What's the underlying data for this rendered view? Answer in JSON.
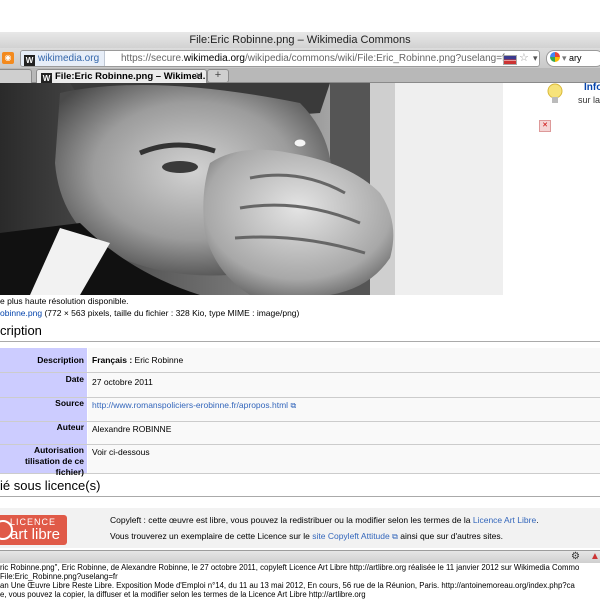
{
  "window": {
    "title": "File:Eric Robinne.png – Wikimedia Commons"
  },
  "navbar": {
    "site_label": "wikimedia.org",
    "url_prefix": "https://secure.",
    "url_domain": "wikimedia.org",
    "url_rest": "/wikipedia/commons/wiki/File:Eric_Robinne.png?uselang=fr",
    "search_value": "ary"
  },
  "tabs": [
    {
      "label": ""
    },
    {
      "label": "File:Eric Robinne.png – Wikimed..."
    }
  ],
  "side": {
    "info_label": "Info",
    "info_sub": "sur la"
  },
  "file": {
    "resolution_text": "e plus haute résolution disponible.",
    "filename": "obinne.png",
    "dimensions": "(772 × 563 pixels, taille du fichier : 328 Kio, type MIME : image/png)"
  },
  "headings": {
    "description": "cription",
    "license": "ié sous licence(s)"
  },
  "info_rows": [
    {
      "label": "Description",
      "value_bold": "Français :",
      "value": "Eric Robinne"
    },
    {
      "label": "Date",
      "value": "27 octobre 2011"
    },
    {
      "label": "Source",
      "value": "http://www.romanspoliciers-erobinne.fr/apropos.html"
    },
    {
      "label": "Auteur",
      "value": "Alexandre ROBINNE"
    },
    {
      "label": "Autorisation",
      "label2": "tilisation de ce fichier)",
      "value": "Voir ci-dessous"
    }
  ],
  "license": {
    "logo_top": "LICENCE",
    "logo_bottom": "art libre",
    "line1_text": "Copyleft : cette œuvre est libre, vous pouvez la redistribuer ou la modifier selon les termes de la",
    "line1_link": "Licence Art Libre",
    "line1_end": ".",
    "line2_text": "Vous trouverez un exemplaire de cette Licence sur le",
    "line2_link": "site Copyleft Attitude",
    "line2_end": "ainsi que sur d'autres sites."
  },
  "caption": [
    "ric Robinne.png\", Eric Robinne, de Alexandre Robinne, le 27 octobre 2011, copyleft Licence Art Libre http://artlibre.org réalisée le 11 janvier 2012 sur Wikimedia Commo",
    "File:Eric_Robinne.png?uselang=fr",
    "an Une Œuvre Libre Reste Libre. Exposition Mode d'Emploi n°14, du 11 au 13 mai 2012, En cours, 56 rue de la Réunion, Paris. http://antoinemoreau.org/index.php?ca",
    "e, vous pouvez la copier, la diffuser et la modifier selon les termes de la Licence Art Libre http://artlibre.org"
  ],
  "colors": {
    "label_bg": "#ccccff",
    "link": "#3366bb",
    "license_logo": "#e05a48"
  },
  "icons": [
    "feed-icon",
    "wikimedia-icon",
    "flag-icon",
    "star-icon",
    "dropdown-icon",
    "reload-icon",
    "google-icon",
    "close-icon",
    "new-tab-icon",
    "lightbulb-icon",
    "external-link-icon",
    "settings-icon",
    "addon-icon"
  ]
}
